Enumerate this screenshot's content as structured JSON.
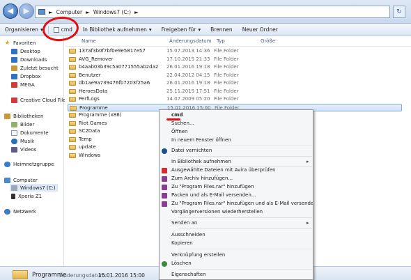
{
  "address": {
    "crumbs": [
      "Computer",
      "Windows7 (C:)"
    ],
    "separator": "►"
  },
  "toolbar": {
    "organize": "Organisieren",
    "cmd": "cmd",
    "library": "In Bibliothek aufnehmen",
    "share": "Freigeben für",
    "burn": "Brennen",
    "new_folder": "Neuer Ordner",
    "dropdown": "▾"
  },
  "nav": {
    "favorites": "Favoriten",
    "fav_items": [
      "Desktop",
      "Downloads",
      "Zuletzt besucht",
      "Dropbox",
      "MEGA",
      "Creative Cloud Files"
    ],
    "libraries": "Bibliotheken",
    "lib_items": [
      "Bilder",
      "Dokumente",
      "Musik",
      "Videos"
    ],
    "homegroup": "Heimnetzgruppe",
    "computer": "Computer",
    "comp_items": [
      "Windows7 (C:)",
      "Xperia Z1"
    ],
    "network": "Netzwerk"
  },
  "columns": {
    "name": "Name",
    "date": "Änderungsdatum",
    "type": "Typ",
    "size": "Größe"
  },
  "files": [
    {
      "name": "137af3b0f7bf0e9e5817e57",
      "date": "15.07.2013 14:36",
      "type": "File Folder"
    },
    {
      "name": "AVG_Remover",
      "date": "17.10.2015 21:33",
      "type": "File Folder"
    },
    {
      "name": "b4aab03b39c5a0771555ab2da2",
      "date": "26.01.2016 19:18",
      "type": "File Folder"
    },
    {
      "name": "Benutzer",
      "date": "22.04.2012 04:15",
      "type": "File Folder"
    },
    {
      "name": "db1ae9a739476fb7203f25a6",
      "date": "26.01.2016 19:18",
      "type": "File Folder"
    },
    {
      "name": "HeroesData",
      "date": "25.11.2015 17:51",
      "type": "File Folder"
    },
    {
      "name": "PerfLogs",
      "date": "14.07.2009 05:20",
      "type": "File Folder"
    },
    {
      "name": "Programme",
      "date": "15.01.2016 15:00",
      "type": "File Folder"
    },
    {
      "name": "Programme (x86)",
      "date": "",
      "type": ""
    },
    {
      "name": "Riot Games",
      "date": "",
      "type": ""
    },
    {
      "name": "SC2Data",
      "date": "",
      "type": ""
    },
    {
      "name": "Temp",
      "date": "",
      "type": ""
    },
    {
      "name": "update",
      "date": "",
      "type": ""
    },
    {
      "name": "Windows",
      "date": "",
      "type": ""
    }
  ],
  "status": {
    "name": "Programme",
    "label": "Änderungsdatum:",
    "value": "15.01.2016 15:00"
  },
  "context_menu": {
    "items": [
      "cmd",
      "Suchen...",
      "Öffnen",
      "In neuem Fenster öffnen",
      "Datei vernichten",
      "In Bibliothek aufnehmen",
      "Ausgewählte Dateien mit Avira überprüfen",
      "Zum Archiv hinzufügen...",
      "Zu \"Program Files.rar\" hinzufügen",
      "Packen und als E-Mail versenden...",
      "Zu \"Program Files.rar\" hinzufügen und als E-Mail versenden",
      "Vorgängerversionen wiederherstellen",
      "Senden an",
      "Ausschneiden",
      "Kopieren",
      "Verknüpfung erstellen",
      "Löschen",
      "Eigenschaften"
    ],
    "arrow": "▸"
  },
  "colors": {
    "annotation_red": "#e01010",
    "selection_blue": "#cfe1f8"
  }
}
